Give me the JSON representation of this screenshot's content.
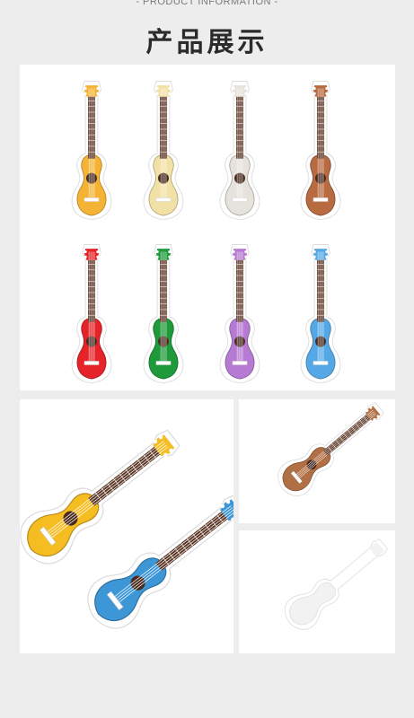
{
  "header": {
    "subtitle": "- PRODUCT INFORMATION -",
    "title": "产品展示"
  },
  "grid": {
    "items": [
      {
        "color": "#f5b335",
        "icon": "ukulele-patch-icon"
      },
      {
        "color": "#f1e1a6",
        "icon": "ukulele-patch-icon"
      },
      {
        "color": "#e6e2dc",
        "icon": "ukulele-patch-icon"
      },
      {
        "color": "#b86a40",
        "icon": "ukulele-patch-icon"
      },
      {
        "color": "#e5242a",
        "icon": "ukulele-patch-icon"
      },
      {
        "color": "#1f9a3a",
        "icon": "ukulele-patch-icon"
      },
      {
        "color": "#b77ad3",
        "icon": "ukulele-patch-icon"
      },
      {
        "color": "#55a8e6",
        "icon": "ukulele-patch-icon"
      }
    ]
  },
  "closeups": {
    "pair_colors": [
      "#f5bd22",
      "#3d96d6"
    ],
    "brown_color": "#b06f45",
    "white_color": "#f4f4f4"
  }
}
